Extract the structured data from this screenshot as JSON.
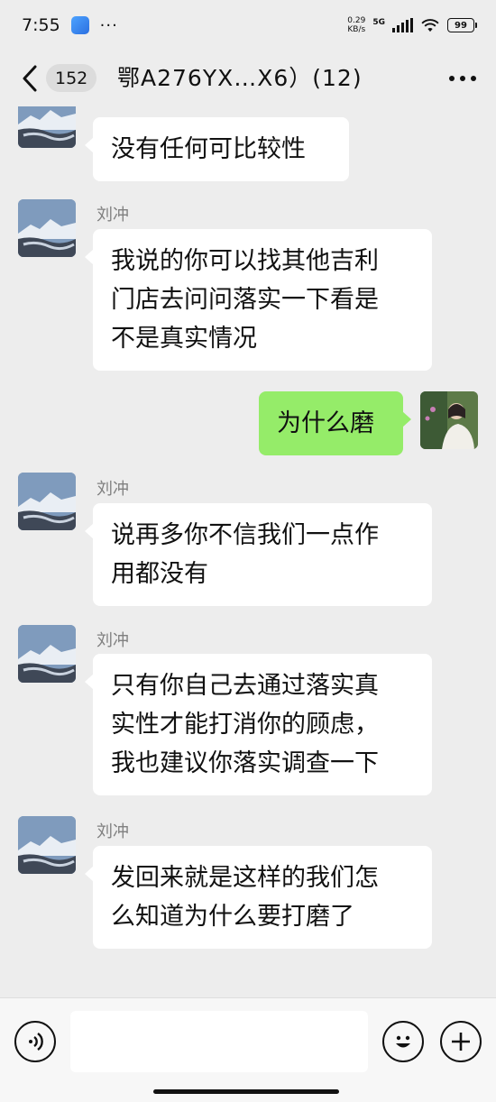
{
  "status_bar": {
    "time": "7:55",
    "dots": "···",
    "net_speed_value": "0.29",
    "net_speed_unit": "KB/s",
    "network": "5G",
    "battery": "99"
  },
  "nav": {
    "unread_count": "152",
    "title": "鄂A276YX…X6）(12)"
  },
  "messages": [
    {
      "side": "left",
      "text": "没有任何可比较性"
    },
    {
      "side": "left",
      "sender": "刘冲",
      "lines": [
        "我说的你可以找其他吉利",
        "门店去问问落实一下看是",
        "不是真实情况"
      ]
    },
    {
      "side": "right",
      "text": "为什么磨"
    },
    {
      "side": "left",
      "sender": "刘冲",
      "lines": [
        "说再多你不信我们一点作",
        "用都没有"
      ]
    },
    {
      "side": "left",
      "sender": "刘冲",
      "lines": [
        "只有你自己去通过落实真",
        "实性才能打消你的顾虑，",
        "我也建议你落实调查一下"
      ]
    },
    {
      "side": "left",
      "sender": "刘冲",
      "lines": [
        "发回来就是这样的我们怎",
        "么知道为什么要打磨了"
      ]
    }
  ],
  "icons": {
    "back": "chevron-left-icon",
    "more": "more-dots-icon",
    "voice": "voice-icon",
    "emoji": "emoji-icon",
    "plus": "plus-icon"
  },
  "colors": {
    "chat_background": "#ededed",
    "self_bubble": "#95ec69",
    "other_bubble": "#ffffff",
    "sender_name": "#808080"
  }
}
